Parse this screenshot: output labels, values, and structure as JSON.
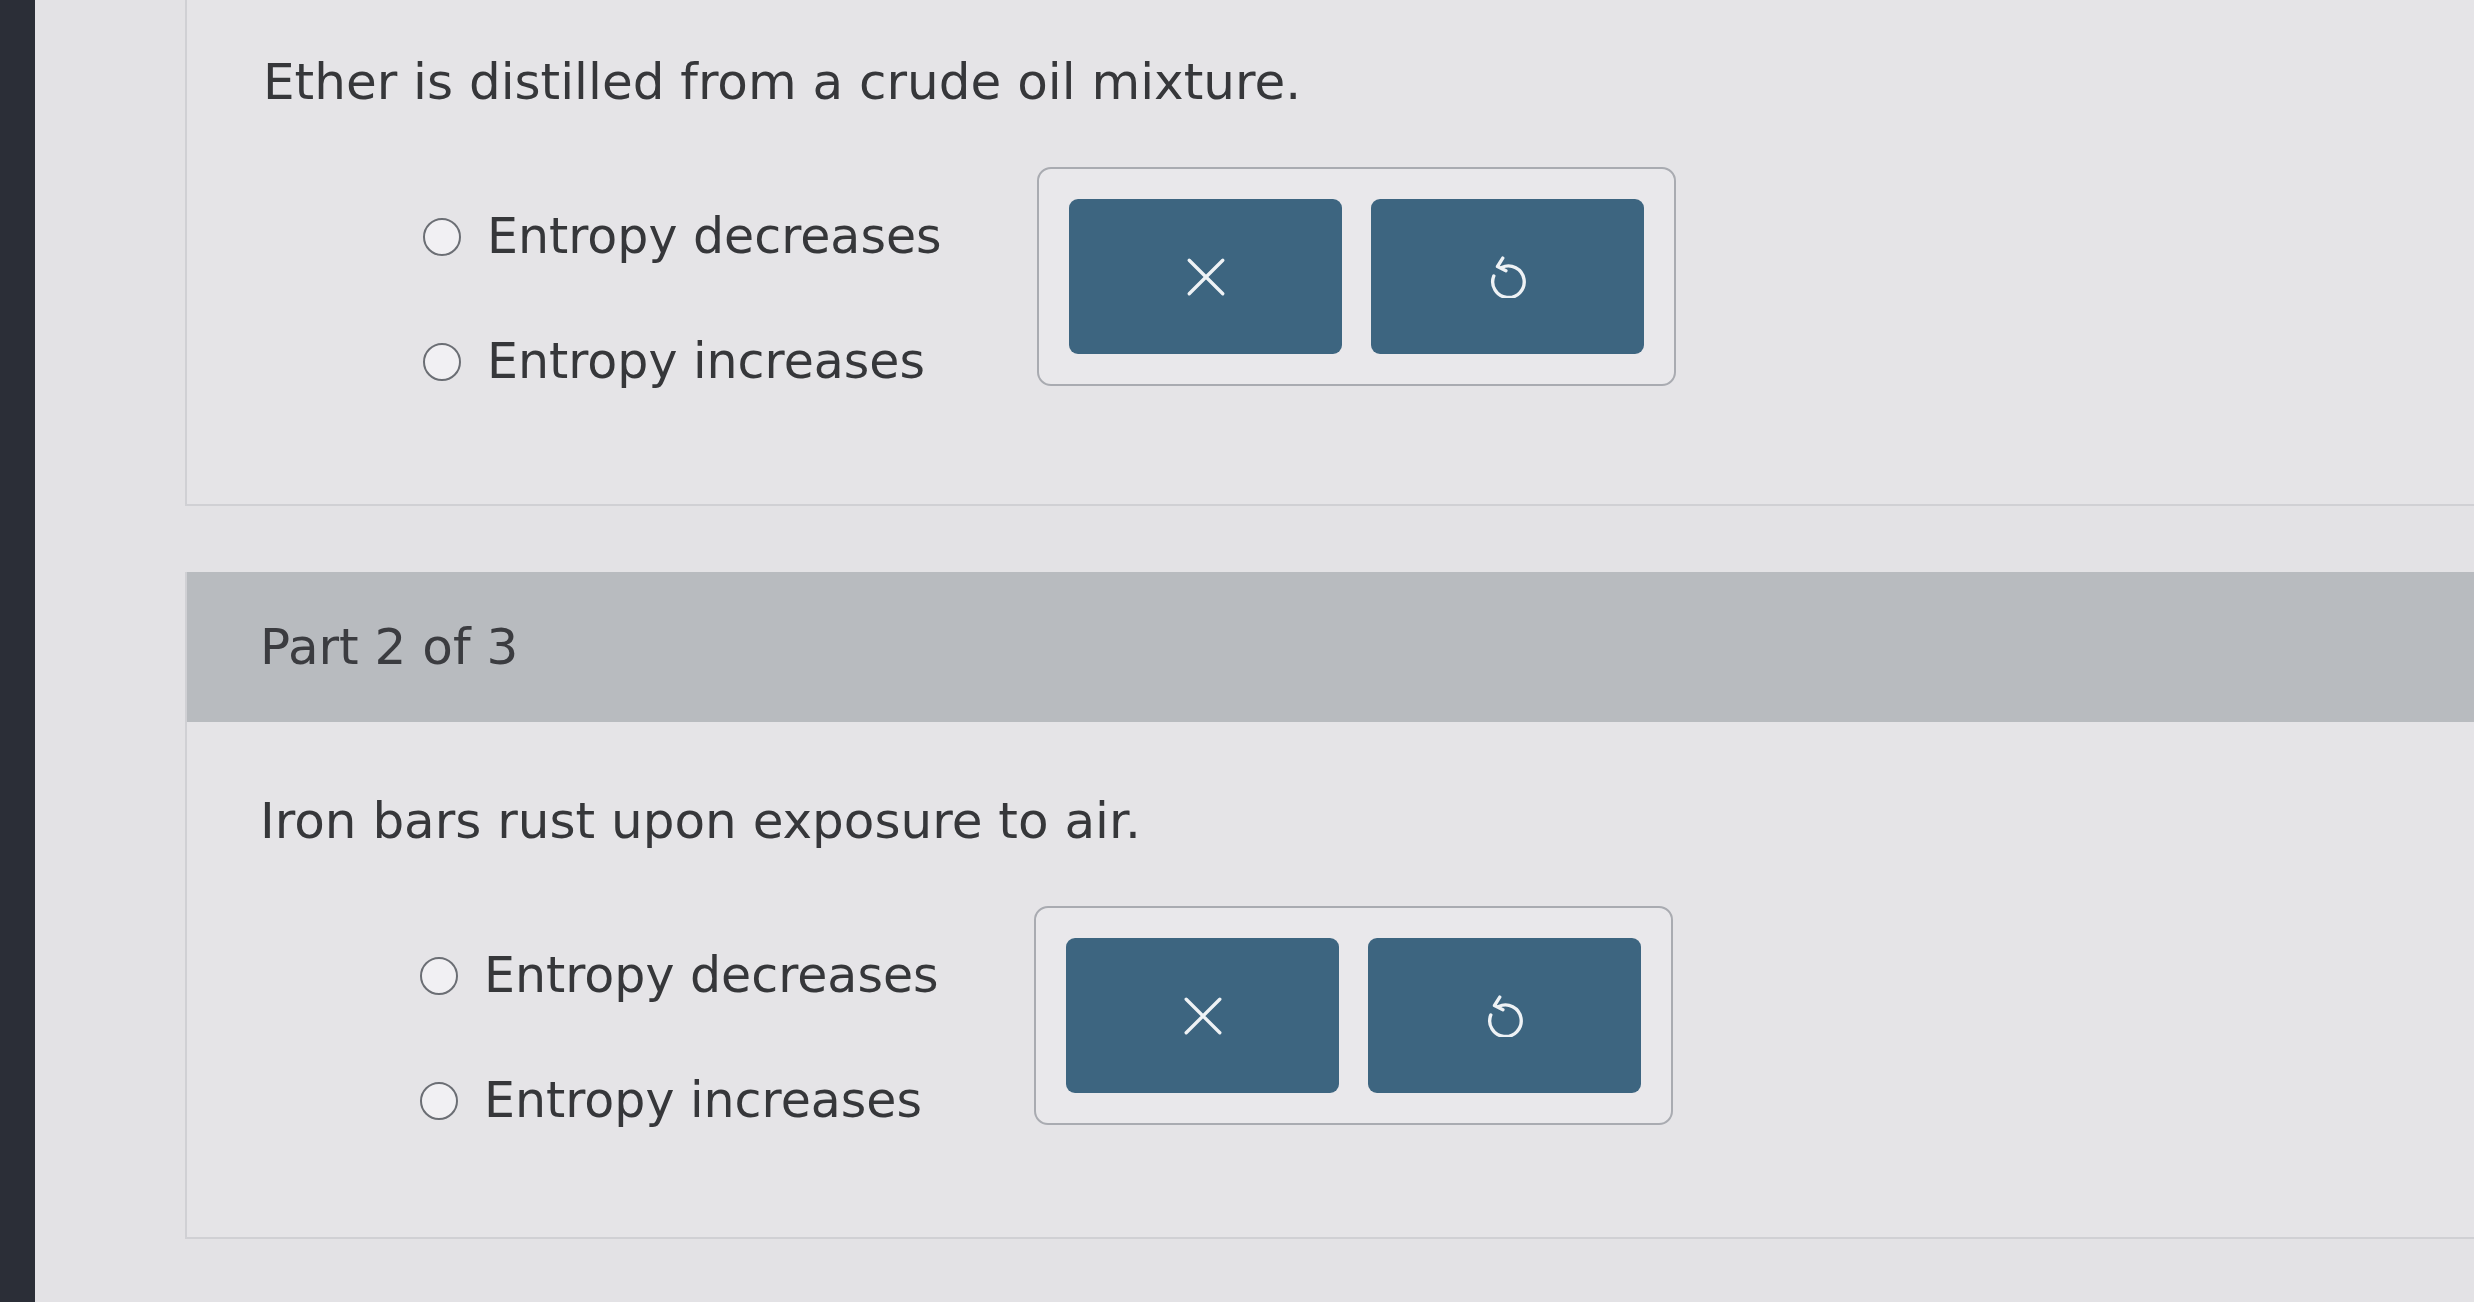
{
  "sections": [
    {
      "prompt": "Ether is distilled from a crude oil mixture.",
      "options": [
        {
          "label": "Entropy decreases",
          "selected": false
        },
        {
          "label": "Entropy increases",
          "selected": false
        }
      ],
      "buttons": [
        {
          "kind": "clear"
        },
        {
          "kind": "undo"
        }
      ]
    },
    {
      "header": "Part 2 of 3",
      "prompt": "Iron bars rust upon exposure to air.",
      "options": [
        {
          "label": "Entropy decreases",
          "selected": false
        },
        {
          "label": "Entropy increases",
          "selected": false
        }
      ],
      "buttons": [
        {
          "kind": "clear"
        },
        {
          "kind": "undo"
        }
      ]
    }
  ]
}
